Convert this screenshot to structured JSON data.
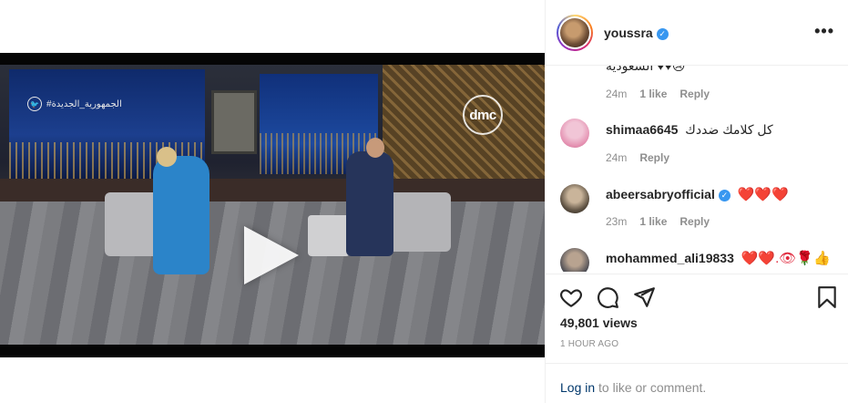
{
  "post": {
    "username": "youssra",
    "verified": true,
    "more_icon": "ellipsis-icon"
  },
  "video": {
    "channel_handle": "#الجمهورية_الجديدة",
    "channel_logo": "dmc",
    "play_icon": "play-icon"
  },
  "comments": [
    {
      "username": "",
      "text": "السعودية ♥♥😢",
      "time": "24m",
      "likes": "1 like",
      "reply": "Reply",
      "partial": true
    },
    {
      "username": "shimaa6645",
      "text": "كل كلامك ضددك",
      "time": "24m",
      "likes": "",
      "reply": "Reply"
    },
    {
      "username": "abeersabryofficial",
      "verified": true,
      "text": "❤️❤️❤️",
      "time": "23m",
      "likes": "1 like",
      "reply": "Reply"
    },
    {
      "username": "mohammed_ali19833",
      "text": "❤️❤️.👁🌹👍",
      "time": "",
      "likes": "",
      "reply": ""
    }
  ],
  "actions": {
    "like_icon": "heart-icon",
    "comment_icon": "comment-icon",
    "share_icon": "share-icon",
    "save_icon": "bookmark-icon"
  },
  "stats": {
    "views": "49,801 views",
    "posted": "1 HOUR AGO"
  },
  "footer": {
    "login_link": "Log in",
    "login_rest": " to like or comment."
  }
}
